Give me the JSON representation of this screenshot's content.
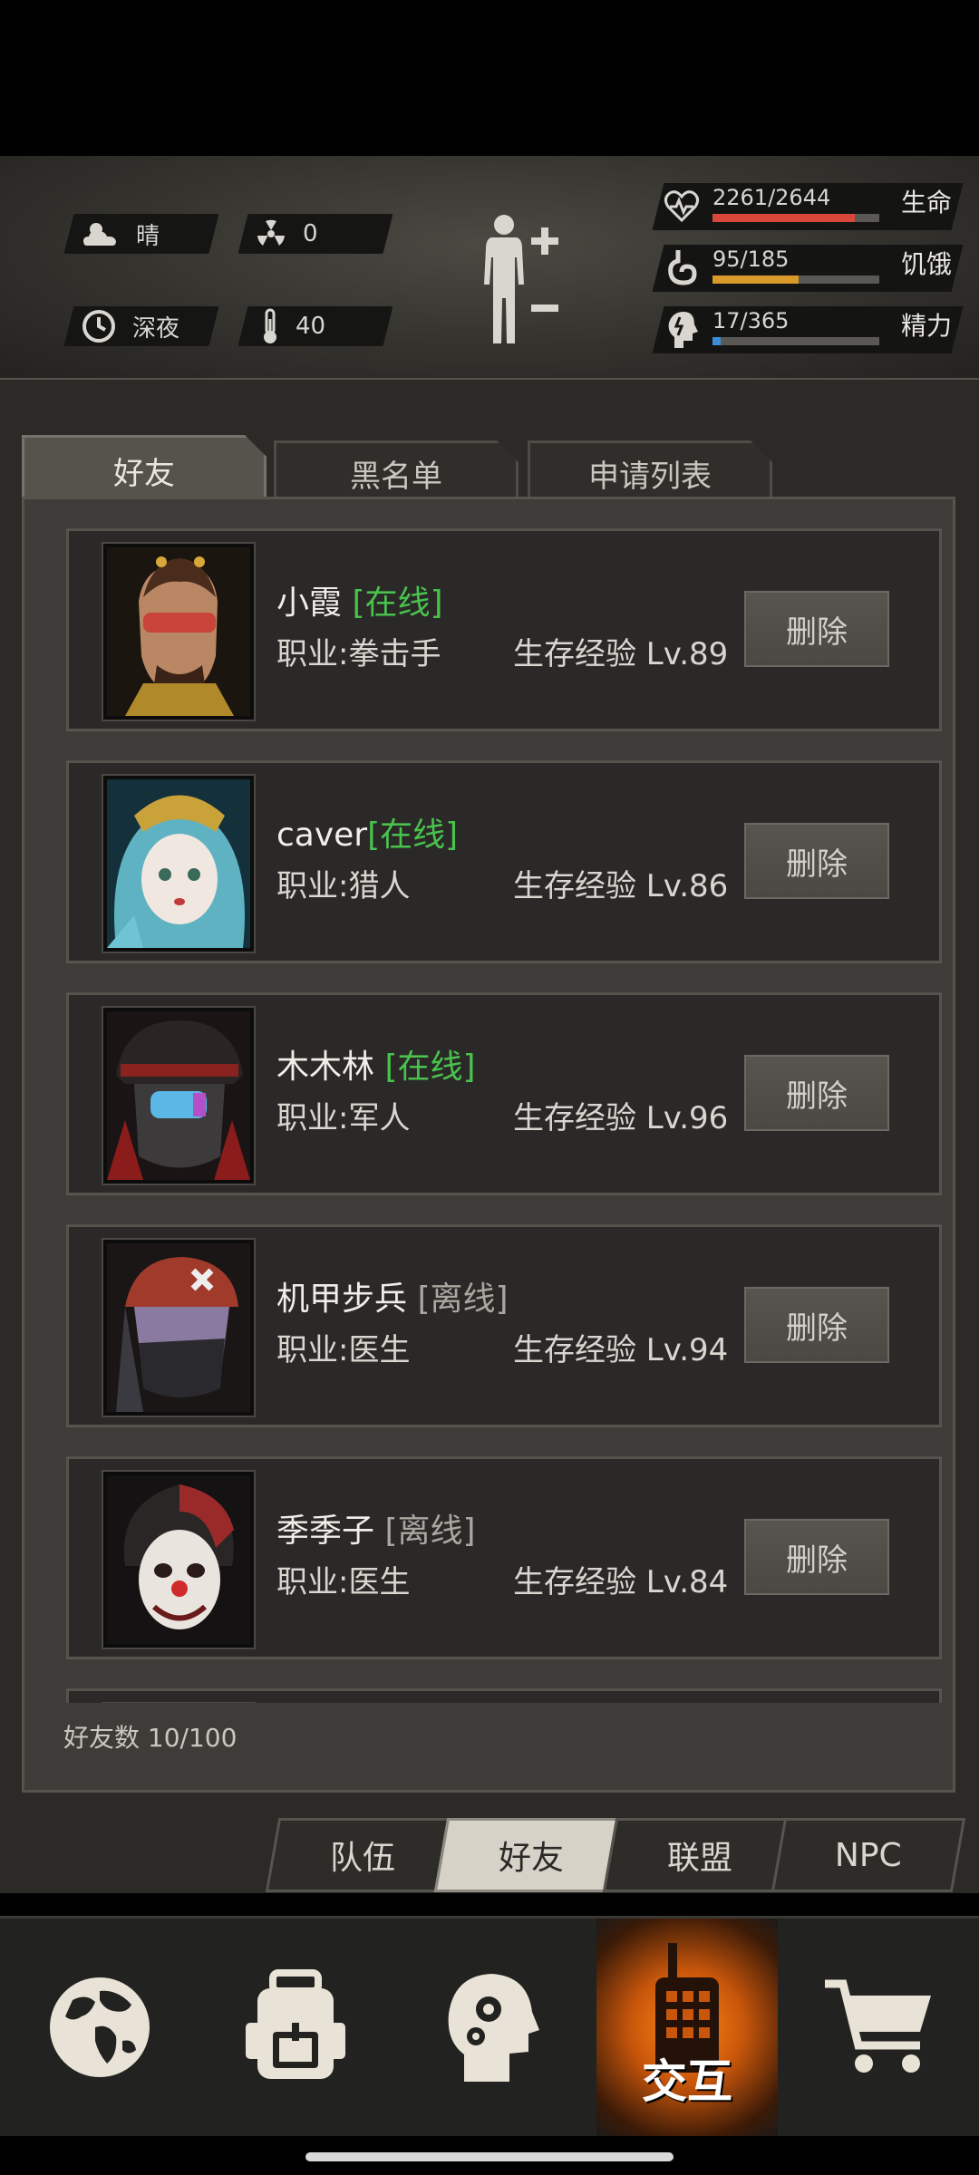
{
  "status": {
    "weather": "晴",
    "radiation": "0",
    "time_of_day": "深夜",
    "temperature": "40",
    "health": {
      "text": "2261/2644",
      "label": "生命",
      "fraction": 0.855,
      "color": "#d9473b"
    },
    "hunger": {
      "text": "95/185",
      "label": "饥饿",
      "fraction": 0.514,
      "color": "#d99a2b"
    },
    "energy": {
      "text": "17/365",
      "label": "精力",
      "fraction": 0.047,
      "color": "#3b8fd9"
    }
  },
  "tabs": [
    "好友",
    "黑名单",
    "申请列表"
  ],
  "friends": [
    {
      "name": "小霞",
      "status": "[在线]",
      "online": true,
      "job_label": "职业:",
      "job": "拳击手",
      "exp": "生存经验 Lv.89",
      "delete": "删除"
    },
    {
      "name": "caver",
      "status": "[在线]",
      "online": true,
      "job_label": "职业:",
      "job": "猎人",
      "exp": "生存经验 Lv.86",
      "delete": "删除"
    },
    {
      "name": "木木林",
      "status": "[在线]",
      "online": true,
      "job_label": "职业:",
      "job": "军人",
      "exp": "生存经验 Lv.96",
      "delete": "删除"
    },
    {
      "name": "机甲步兵",
      "status": "[离线]",
      "online": false,
      "job_label": "职业:",
      "job": "医生",
      "exp": "生存经验 Lv.94",
      "delete": "删除"
    },
    {
      "name": "季季子",
      "status": "[离线]",
      "online": false,
      "job_label": "职业:",
      "job": "医生",
      "exp": "生存经验 Lv.84",
      "delete": "删除"
    }
  ],
  "friend_count": "好友数 10/100",
  "subtabs": [
    "队伍",
    "好友",
    "联盟",
    "NPC"
  ],
  "bottom_nav": {
    "items": [
      "globe-icon",
      "backpack-icon",
      "skills-head-icon",
      "walkie-talkie-icon",
      "cart-icon"
    ],
    "active_label": "交互"
  }
}
